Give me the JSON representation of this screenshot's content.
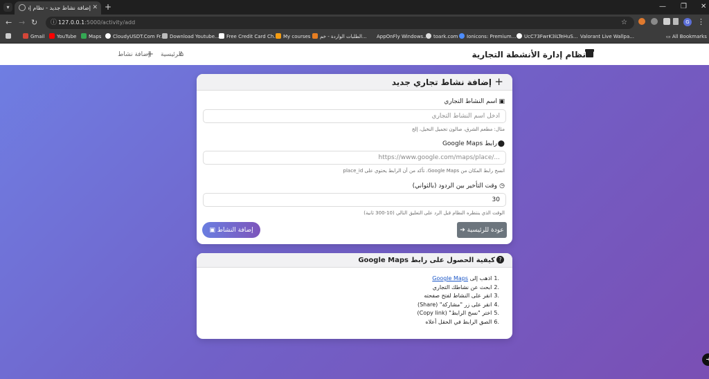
{
  "browser": {
    "tab_title": "إضافة نشاط جديد - نظام إدارة الأ",
    "tab_close": "✕",
    "new_tab": "+",
    "url_host": "127.0.0.1",
    "url_path": ":5000/activity/add",
    "bookmarks": [
      "Gmail",
      "YouTube",
      "Maps",
      "CloudyUSDT.Com Fr...",
      "Download Youtube...",
      "Free Credit Card Ch...",
      "My courses",
      "الطلبات الواردة - خم...",
      "AppOnFly Windows...",
      "toark.com",
      "Ionicons: Premium...",
      "UcC73FwrK3iLTeHuS...",
      "Valorant Live Wallpa..."
    ],
    "all_bookmarks": "All Bookmarks",
    "profile_initial": "G"
  },
  "navbar": {
    "brand": "نظام إدارة الأنشطة التجارية",
    "home_link": "الرئيسية",
    "add_link": "إضافة نشاط"
  },
  "form_card": {
    "title": "إضافة نشاط تجاري جديد",
    "name_label": "اسم النشاط التجاري",
    "name_placeholder": "أدخل اسم النشاط التجاري",
    "name_hint": "مثال: مطعم الشرق، صالون تجميل النخيل، إلخ",
    "maps_label": "رابط Google Maps",
    "maps_placeholder": "https://www.google.com/maps/place/...",
    "maps_hint": "انسخ رابط المكان من Google Maps. تأكد من أن الرابط يحتوي على place_id",
    "delay_label": "وقت التأخير بين الردود (بالثواني)",
    "delay_value": "30",
    "delay_hint": "الوقت الذي ينتظره النظام قبل الرد على التعليق التالي (10-300 ثانية)",
    "submit_label": "إضافة النشاط",
    "back_label": "عودة للرئيسية"
  },
  "help_card": {
    "title": "كيفية الحصول على رابط Google Maps",
    "step1_prefix": "اذهب إلى",
    "step1_link": "Google Maps",
    "steps": [
      "ابحث عن نشاطك التجاري",
      "انقر على النشاط لفتح صفحته",
      "انقر على زر \"مشاركة\" (Share)",
      "اختر \"نسخ الرابط\" (Copy link)",
      "الصق الرابط في الحقل أعلاه"
    ]
  },
  "colors": {
    "gradient_start": "#6f7fe3",
    "gradient_end": "#7a4fb4",
    "back_button": "#6c757d"
  }
}
